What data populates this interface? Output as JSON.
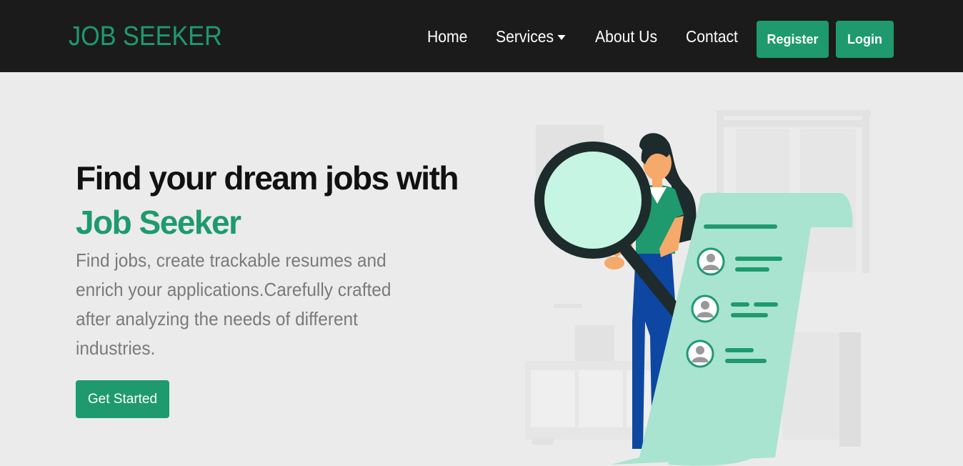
{
  "brand": "JOB SEEKER",
  "nav": {
    "home": "Home",
    "services": "Services",
    "about": "About Us",
    "contact": "Contact",
    "register": "Register",
    "login": "Login"
  },
  "hero": {
    "title_main": "Find your dream jobs with ",
    "title_accent": "Job Seeker",
    "subtitle": "Find jobs, create trackable resumes and enrich your applications.Carefully crafted after analyzing the needs of different industries.",
    "cta": "Get Started"
  },
  "colors": {
    "accent": "#1e9a6e",
    "navbar": "#1c1b1b",
    "background": "#ebebeb"
  }
}
